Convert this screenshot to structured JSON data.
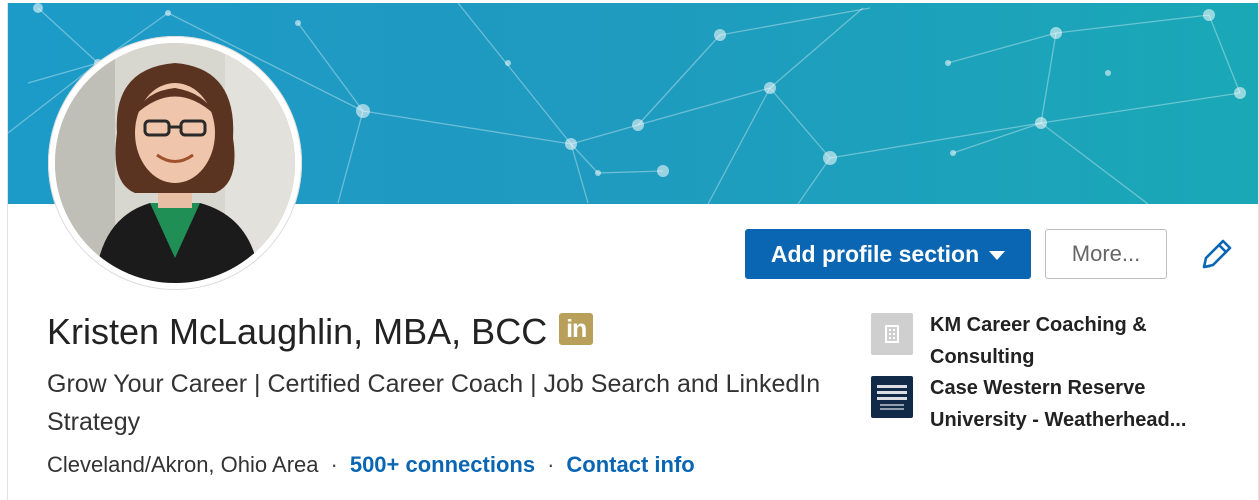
{
  "profile": {
    "name": "Kristen McLaughlin, MBA, BCC",
    "badge_text": "in",
    "headline": "Grow Your Career | Certified Career Coach | Job Search and LinkedIn Strategy",
    "location": "Cleveland/Akron, Ohio Area",
    "separator": "·",
    "connections": "500+ connections",
    "contact_info": "Contact info"
  },
  "actions": {
    "add_section_label": "Add profile section",
    "more_label": "More..."
  },
  "affiliations": [
    {
      "name": "KM Career Coaching & Consulting",
      "icon": "building-icon"
    },
    {
      "name": "Case Western Reserve University - Weatherhead...",
      "icon": "university-logo"
    }
  ],
  "colors": {
    "primary": "#0a66b2",
    "banner": "#1c9bc8",
    "badge": "#b8a05a"
  }
}
